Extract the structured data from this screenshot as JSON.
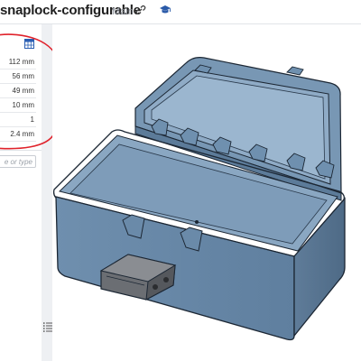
{
  "header": {
    "doc_title": "snaplock-configurable",
    "workspace": "Main"
  },
  "parameters": {
    "rows": [
      {
        "value": "112 mm"
      },
      {
        "value": "56 mm"
      },
      {
        "value": "49 mm"
      },
      {
        "value": "10 mm"
      },
      {
        "value": "1"
      },
      {
        "value": "2.4 mm"
      }
    ]
  },
  "search": {
    "placeholder_fragment": "e or type"
  },
  "colors": {
    "annotation": "#e0222b",
    "box_fill": "#6d8fb0",
    "box_edge": "#1c2734",
    "hinge": "#6b6e73"
  },
  "icons": {
    "link": "link-icon",
    "cap": "graduation-cap-icon",
    "table": "table-icon",
    "list": "list-icon"
  }
}
